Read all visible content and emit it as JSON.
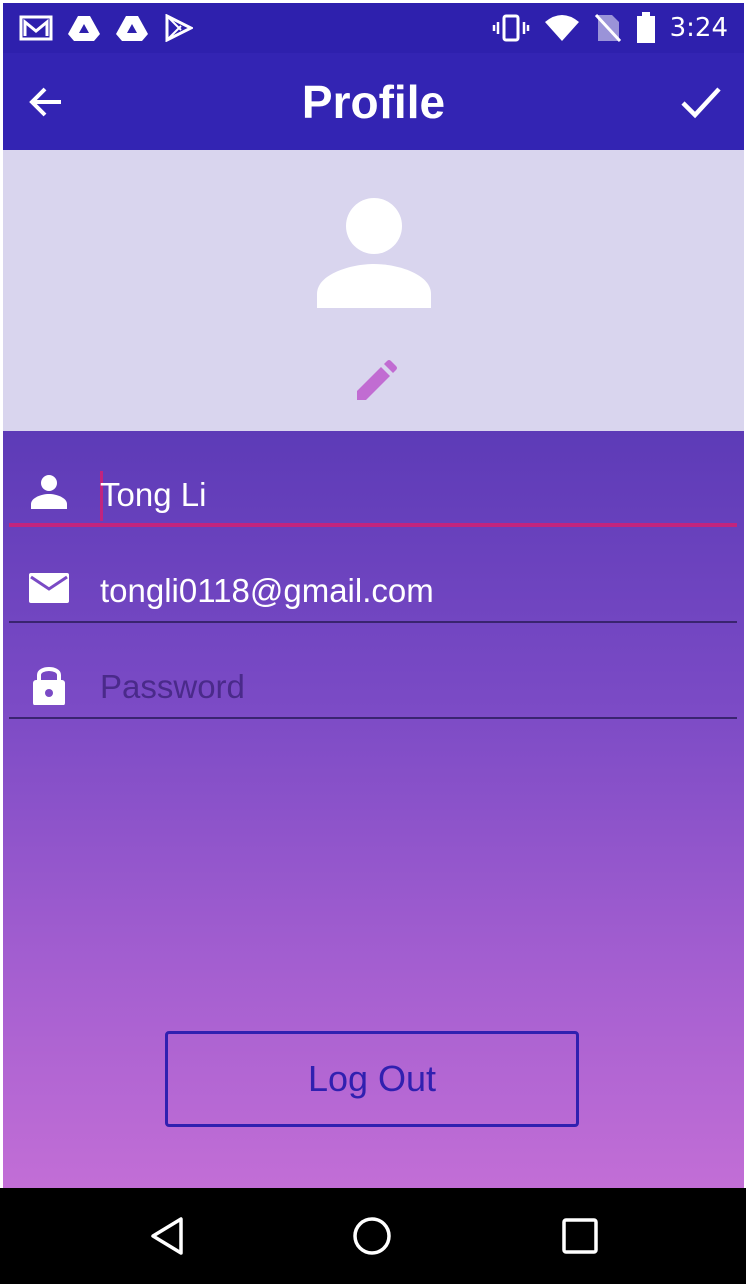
{
  "status_bar": {
    "time": "3:24",
    "left_icons": [
      "gmail-icon",
      "drive-icon",
      "drive-icon",
      "play-store-icon"
    ],
    "right_icons": [
      "vibrate-icon",
      "wifi-icon",
      "no-sim-icon",
      "battery-icon"
    ]
  },
  "app_bar": {
    "title": "Profile",
    "back_icon": "arrow-back-icon",
    "confirm_icon": "check-icon"
  },
  "avatar": {
    "icon": "person-icon",
    "edit_icon": "pencil-icon"
  },
  "form": {
    "name_value": "Tong Li",
    "email_value": "tongli0118@gmail.com",
    "password_placeholder": "Password"
  },
  "logout_label": "Log Out",
  "nav": {
    "back": "nav-back-icon",
    "home": "nav-home-icon",
    "recents": "nav-recents-icon"
  },
  "colors": {
    "app_bar": "#3324b3",
    "accent": "#c2247e",
    "button_outline": "#3020b0",
    "avatar_bg": "#d9d5ee"
  }
}
